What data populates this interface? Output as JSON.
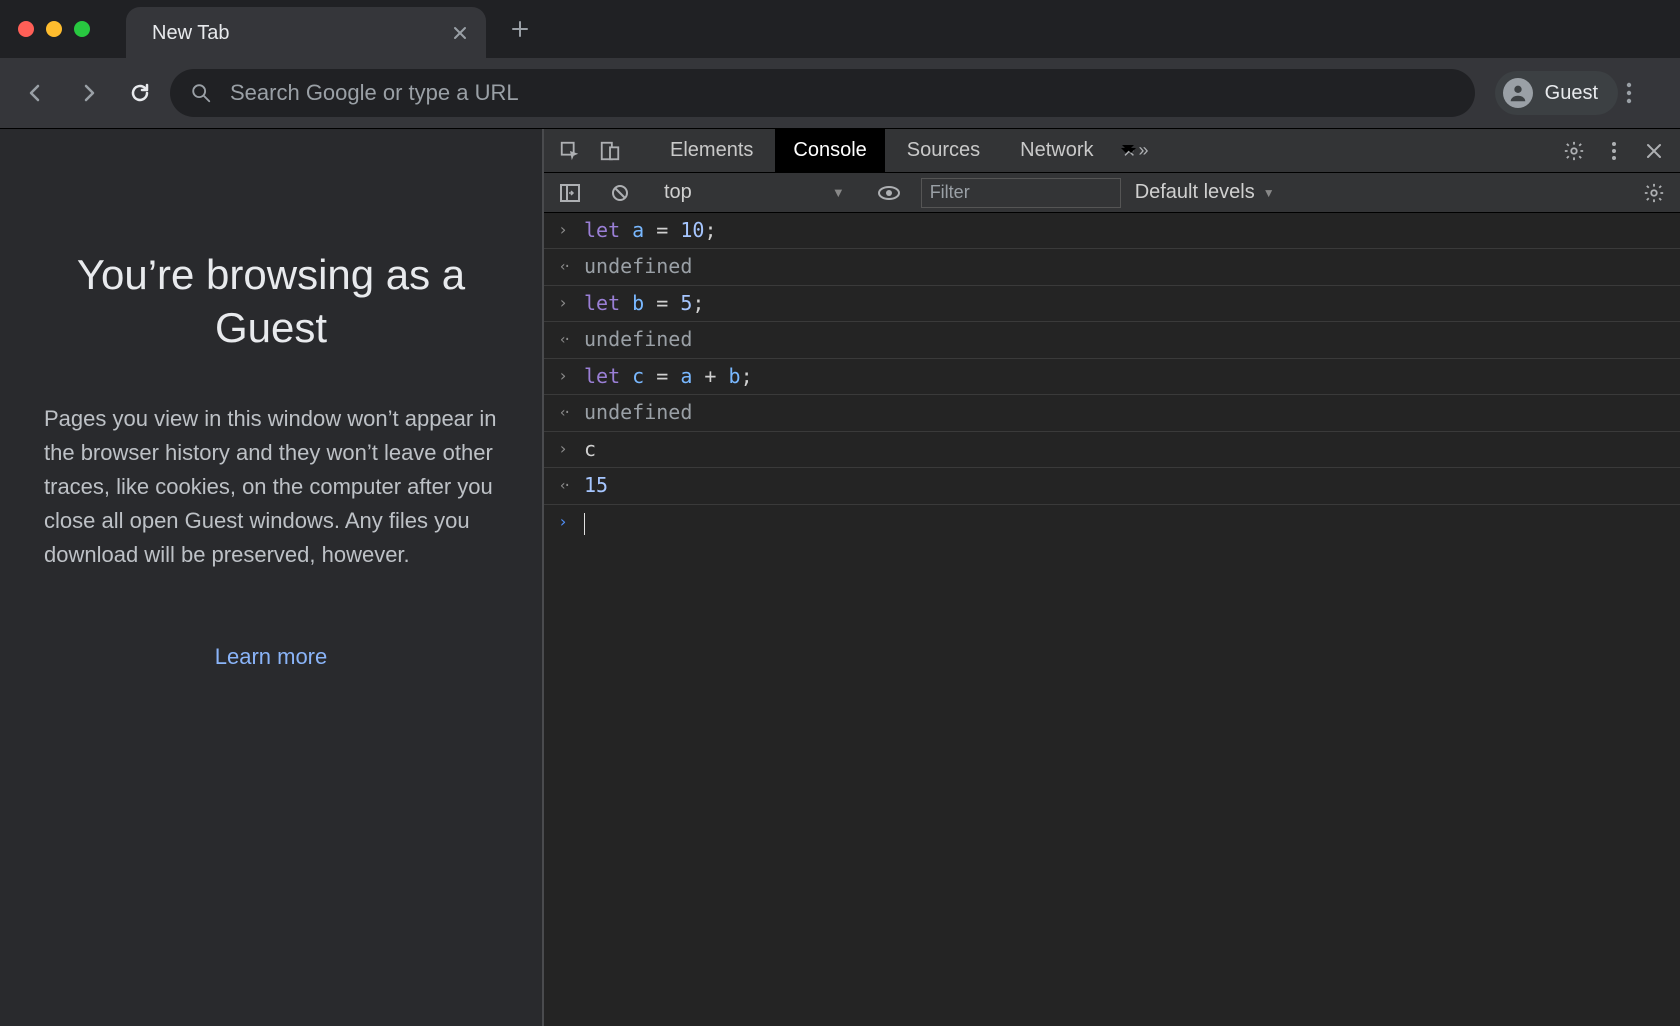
{
  "browser": {
    "tab_title": "New Tab",
    "omnibox_placeholder": "Search Google or type a URL",
    "profile_label": "Guest"
  },
  "guest_page": {
    "heading": "You’re browsing as a Guest",
    "body": "Pages you view in this window won’t appear in the browser history and they won’t leave other traces, like cookies, on the computer after you close all open Guest windows. Any files you download will be preserved, however.",
    "learn_more": "Learn more"
  },
  "devtools": {
    "tabs": {
      "elements": "Elements",
      "console": "Console",
      "sources": "Sources",
      "network": "Network"
    },
    "filterbar": {
      "context": "top",
      "filter_placeholder": "Filter",
      "levels_label": "Default levels"
    },
    "console_entries": [
      {
        "type": "input",
        "tokens": [
          [
            "kw",
            "let "
          ],
          [
            "ident",
            "a"
          ],
          [
            "op",
            " = "
          ],
          [
            "num",
            "10"
          ],
          [
            "op",
            ";"
          ]
        ]
      },
      {
        "type": "output",
        "value": "undefined",
        "cls": "undef"
      },
      {
        "type": "input",
        "tokens": [
          [
            "kw",
            "let "
          ],
          [
            "ident",
            "b"
          ],
          [
            "op",
            " = "
          ],
          [
            "num",
            "5"
          ],
          [
            "op",
            ";"
          ]
        ]
      },
      {
        "type": "output",
        "value": "undefined",
        "cls": "undef"
      },
      {
        "type": "input",
        "tokens": [
          [
            "kw",
            "let "
          ],
          [
            "ident",
            "c"
          ],
          [
            "op",
            " = "
          ],
          [
            "ident",
            "a"
          ],
          [
            "op",
            " + "
          ],
          [
            "ident",
            "b"
          ],
          [
            "op",
            ";"
          ]
        ]
      },
      {
        "type": "output",
        "value": "undefined",
        "cls": "undef"
      },
      {
        "type": "input",
        "tokens": [
          [
            "op",
            "c"
          ]
        ]
      },
      {
        "type": "output",
        "value": "15",
        "cls": "result"
      }
    ]
  }
}
